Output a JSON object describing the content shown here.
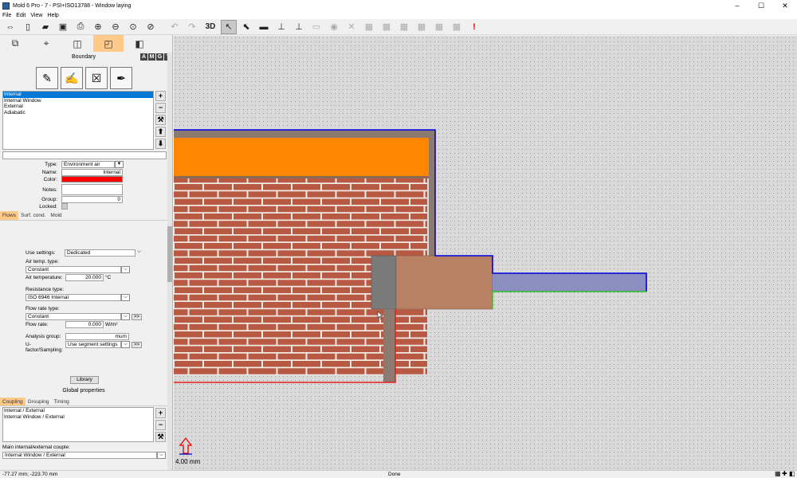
{
  "window": {
    "title": "Mold 6 Pro - 7 - PSI+ISO13788 - Window laying",
    "minimize": "–",
    "maximize": "☐",
    "close": "✕"
  },
  "menu": [
    "File",
    "Edit",
    "View",
    "Help"
  ],
  "toolbar": {
    "view3d": "3D"
  },
  "sidebar": {
    "boundary_header": "Boundary",
    "amg": [
      "A",
      "M",
      "G",
      "?"
    ],
    "boundary_list": [
      "Internal",
      "Internal Window",
      "External",
      "Adiabatic"
    ],
    "props": {
      "type_label": "Type:",
      "type_value": "Environment air",
      "name_label": "Name:",
      "name_value": "Internal",
      "color_label": "Color:",
      "color_value": "#ff0000",
      "notes_label": "Notes:",
      "group_label": "Group:",
      "group_value": "0",
      "locked_label": "Locked:"
    },
    "tabs": [
      "Flows",
      "Surf. cond.",
      "Mold"
    ],
    "flows": {
      "use_settings_label": "Use settings:",
      "use_settings_value": "Dedicated",
      "air_temp_type_label": "Air temp. type:",
      "air_temp_type_value": "Constant",
      "air_temp_label": "Air temperature:",
      "air_temp_value": "20.000",
      "air_temp_unit": "°C",
      "resistance_type_label": "Resistance type:",
      "resistance_type_value": "ISO 6946 Internal",
      "flow_rate_type_label": "Flow rate type:",
      "flow_rate_type_value": "Constant",
      "flow_rate_label": "Flow rate:",
      "flow_rate_value": "0.000",
      "flow_rate_unit": "W/m²",
      "analysis_group_label": "Analysis group:",
      "analysis_group_value": "mum",
      "ufactor_label": "U-factor/Sampling:",
      "ufactor_value": "Use segment settings",
      "more": ">>"
    },
    "library_button": "Library",
    "global_header": "Global properties",
    "global_tabs": [
      "Coupling",
      "Grouping",
      "Timing"
    ],
    "coupling_list": [
      "Internal / External",
      "Internal Window / External"
    ],
    "main_couple_label": "Main internal/external couple:",
    "main_couple_value": "Internal Window / External"
  },
  "canvas": {
    "scale_label": "4.00 mm"
  },
  "status": {
    "coords": "-77.27 mm; -223.70 mm",
    "state": "Done"
  }
}
